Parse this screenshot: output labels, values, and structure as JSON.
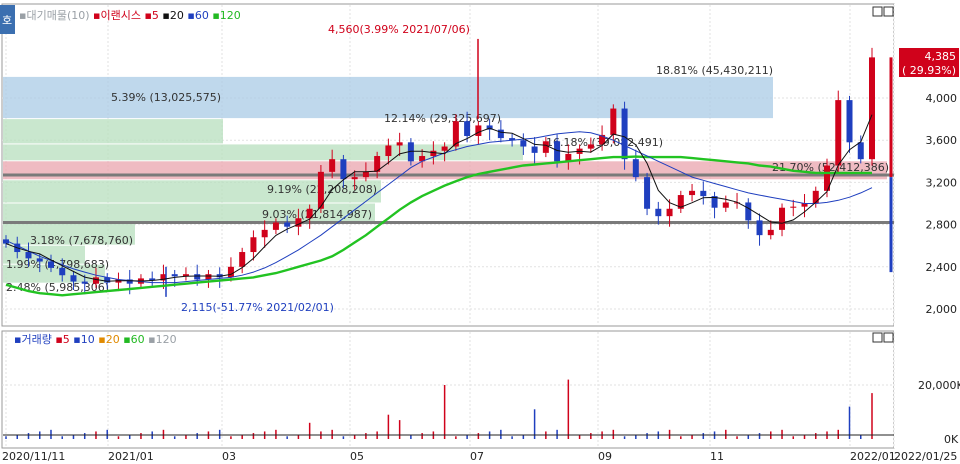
{
  "price_panel": {
    "prefix": "호",
    "legend_parts": [
      {
        "text": "대기매물(10)",
        "color": "#9aa0a6"
      },
      {
        "text": "이랜시스",
        "color": "#d0021b"
      },
      {
        "text": "5",
        "color": "#d0021b"
      },
      {
        "text": "20",
        "color": "#111111"
      },
      {
        "text": "60",
        "color": "#1f3fbf"
      },
      {
        "text": "120",
        "color": "#22b922"
      }
    ],
    "current_price": "4,385",
    "current_change": "( 29.93%)",
    "high_annotation": "4,560(3.99% 2021/07/06)",
    "low_annotation": "2,115(-51.77% 2021/02/01)",
    "volume_profile_labels": [
      "18.81% (45,430,211)",
      "5.39% (13,025,575)",
      "12.14% (29,325,697)",
      "16.18% (39,082,491)",
      "21.70% (52,412,386)",
      "9.19% (22,208,208)",
      "9.03% (21,814,987)",
      "3.18% (7,678,760)",
      "1.99% (4,798,683)",
      "2.48% (5,985,306)"
    ]
  },
  "volume_panel": {
    "legend_parts": [
      {
        "text": "거래량",
        "color": "#1f3fbf"
      },
      {
        "text": "5",
        "color": "#d0021b"
      },
      {
        "text": "10",
        "color": "#1f3fbf"
      },
      {
        "text": "20",
        "color": "#e08a00"
      },
      {
        "text": "60",
        "color": "#22b922"
      },
      {
        "text": "120",
        "color": "#9aa0a6"
      }
    ],
    "y_ticks": [
      "20,000K",
      "0K"
    ]
  },
  "chart_data": {
    "type": "candlestick",
    "y_ticks": [
      4000,
      3600,
      3200,
      2800,
      2400,
      2000
    ],
    "x_labels": [
      "2020/11/11",
      "2021/01",
      "03",
      "05",
      "07",
      "09",
      "11",
      "2022/01",
      "2022/01/25"
    ],
    "current_price": 4385,
    "high": {
      "price": 4560,
      "date": "2021/07/06"
    },
    "low": {
      "price": 2115,
      "date": "2021/02/01"
    },
    "support_lines": [
      3270,
      2820
    ],
    "close_series": [
      2620,
      2540,
      2480,
      2450,
      2390,
      2320,
      2260,
      2240,
      2300,
      2250,
      2280,
      2240,
      2290,
      2270,
      2330,
      2310,
      2330,
      2280,
      2330,
      2300,
      2400,
      2540,
      2680,
      2750,
      2820,
      2780,
      2860,
      2950,
      3300,
      3420,
      3230,
      3250,
      3300,
      3450,
      3550,
      3580,
      3400,
      3450,
      3500,
      3540,
      3780,
      3640,
      3740,
      3700,
      3620,
      3600,
      3540,
      3480,
      3590,
      3400,
      3470,
      3520,
      3560,
      3650,
      3900,
      3420,
      3250,
      2950,
      2880,
      2950,
      3080,
      3120,
      3070,
      2960,
      3010,
      3010,
      2840,
      2700,
      2750,
      2960,
      2970,
      3000,
      3120,
      3360,
      3980,
      3580,
      3420,
      4385
    ],
    "ma120": [
      2230,
      2200,
      2170,
      2150,
      2140,
      2130,
      2140,
      2150,
      2160,
      2170,
      2180,
      2190,
      2200,
      2210,
      2220,
      2230,
      2240,
      2250,
      2260,
      2270,
      2280,
      2290,
      2300,
      2320,
      2340,
      2370,
      2400,
      2430,
      2460,
      2500,
      2560,
      2630,
      2700,
      2780,
      2860,
      2940,
      3010,
      3070,
      3120,
      3170,
      3210,
      3250,
      3280,
      3300,
      3320,
      3340,
      3360,
      3370,
      3380,
      3390,
      3400,
      3410,
      3420,
      3430,
      3440,
      3440,
      3445,
      3440,
      3440,
      3440,
      3440,
      3430,
      3420,
      3410,
      3400,
      3390,
      3380,
      3360,
      3350,
      3330,
      3310,
      3300,
      3290,
      3290,
      3290,
      3290,
      3290,
      3290
    ],
    "ma60": [
      2650,
      2600,
      2550,
      2500,
      2460,
      2420,
      2380,
      2350,
      2320,
      2300,
      2280,
      2270,
      2260,
      2250,
      2250,
      2250,
      2260,
      2270,
      2280,
      2290,
      2300,
      2320,
      2350,
      2390,
      2440,
      2500,
      2560,
      2630,
      2700,
      2780,
      2860,
      2940,
      3020,
      3100,
      3180,
      3260,
      3340,
      3400,
      3440,
      3480,
      3510,
      3540,
      3560,
      3580,
      3590,
      3600,
      3610,
      3620,
      3640,
      3660,
      3670,
      3680,
      3670,
      3640,
      3600,
      3550,
      3500,
      3450,
      3400,
      3350,
      3300,
      3250,
      3220,
      3190,
      3160,
      3130,
      3100,
      3080,
      3060,
      3040,
      3020,
      3000,
      3000,
      3010,
      3030,
      3060,
      3100,
      3150
    ]
  }
}
